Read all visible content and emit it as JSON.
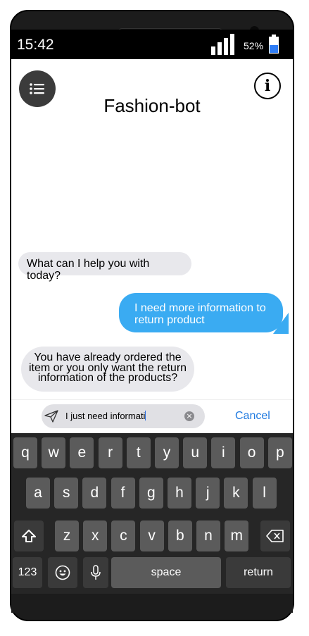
{
  "status": {
    "time": "15:42",
    "battery": "52%",
    "battery_level": 0.52
  },
  "header": {
    "title": "Fashion-bot",
    "menu_icon": "list-icon",
    "info_icon": "info-icon",
    "info_glyph": "i"
  },
  "messages": [
    {
      "sender": "bot",
      "text": "What can I help you with today?"
    },
    {
      "sender": "user",
      "lines": [
        "I need more information to",
        "return product"
      ]
    },
    {
      "sender": "bot",
      "lines": [
        "You have already ordered the",
        "item or you only want the return",
        "information of the products?"
      ]
    }
  ],
  "input": {
    "value": "I just need informati",
    "send_icon": "send-icon",
    "clear_icon": "clear-icon",
    "cancel_label": "Cancel"
  },
  "keyboard": {
    "row1": [
      "q",
      "w",
      "e",
      "r",
      "t",
      "y",
      "u",
      "i",
      "o",
      "p"
    ],
    "row2": [
      "a",
      "s",
      "d",
      "f",
      "g",
      "h",
      "j",
      "k",
      "l"
    ],
    "row3": [
      "z",
      "x",
      "c",
      "v",
      "b",
      "n",
      "m"
    ],
    "numbers_label": "123",
    "space_label": "space",
    "return_label": "return",
    "shift_icon": "shift-icon",
    "delete_icon": "backspace-icon",
    "emoji_icon": "emoji-icon",
    "mic_icon": "microphone-icon"
  },
  "colors": {
    "user_bubble": "#3aabf2",
    "bot_bubble": "#e8e8ec",
    "accent": "#1f7ae0"
  }
}
